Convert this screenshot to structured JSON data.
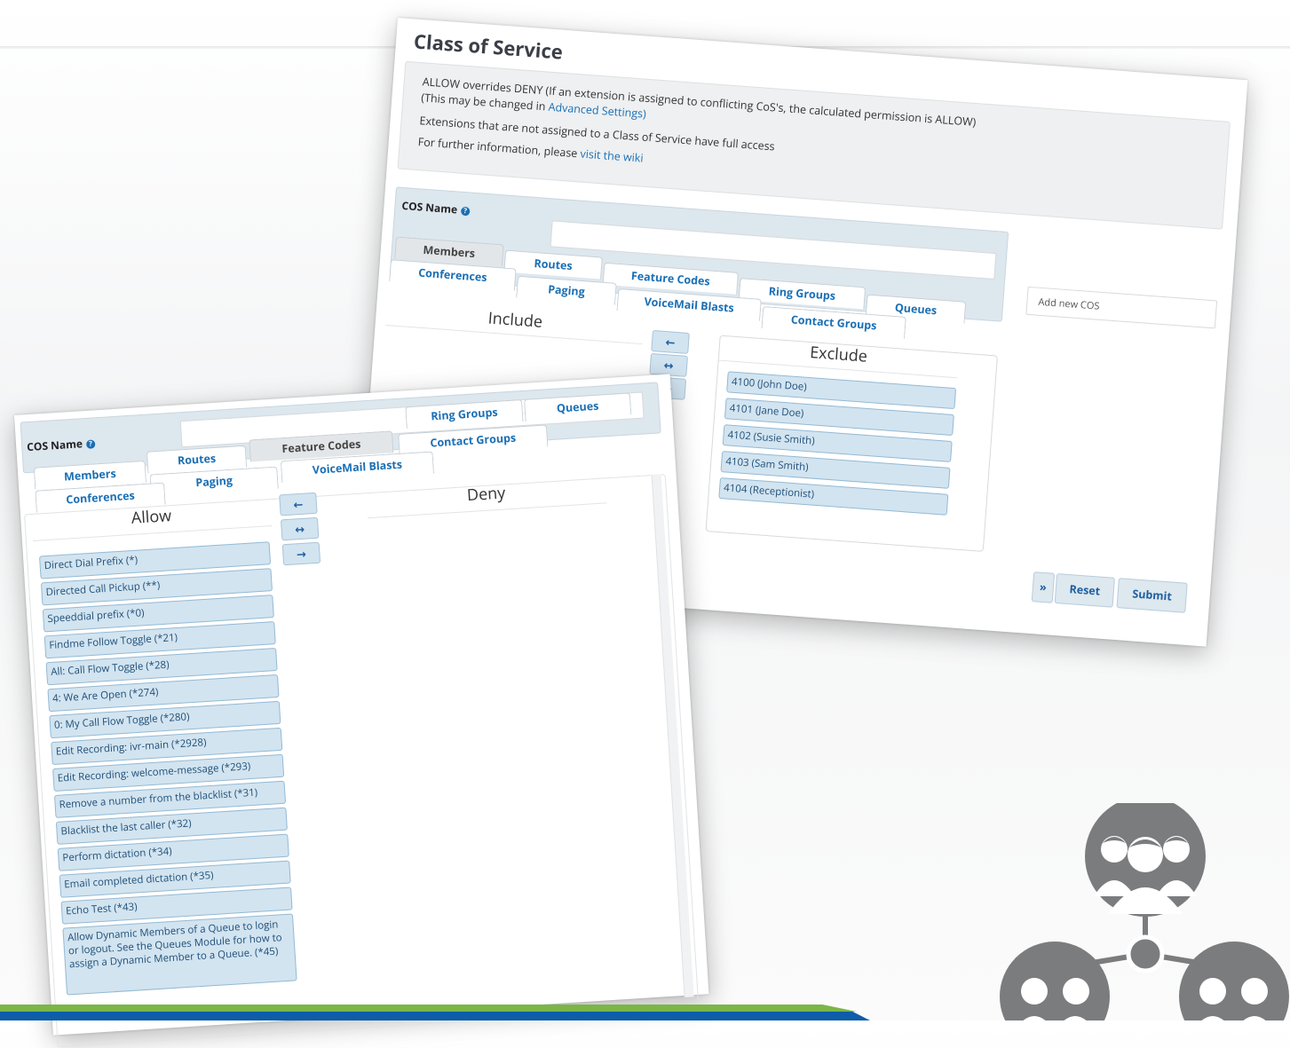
{
  "back": {
    "title": "Class of Service",
    "info": {
      "line1": "ALLOW overrides DENY (If an extension is assigned to conflicting CoS's, the calculated permission is ALLOW)",
      "line2_prefix": "(This may be changed in ",
      "line2_link": "Advanced Settings",
      "line2_suffix": ")",
      "line3": "Extensions that are not assigned to a Class of Service have full access",
      "line4_prefix": "For further information, please ",
      "line4_link": "visit the wiki"
    },
    "cos_name_label": "COS Name",
    "tabs": [
      "Members",
      "Routes",
      "Feature Codes",
      "Ring Groups",
      "Queues",
      "Conferences",
      "Paging",
      "VoiceMail Blasts",
      "Contact Groups"
    ],
    "include_label": "Include",
    "exclude_label": "Exclude",
    "exclude_items": [
      "4100 (John Doe)",
      "4101 (Jane Doe)",
      "4102 (Susie Smith)",
      "4103 (Sam Smith)",
      "4104 (Receptionist)"
    ],
    "add_new_cos_placeholder": "Add new COS",
    "reset_label": "Reset",
    "submit_label": "Submit",
    "collapse_label": "»"
  },
  "front": {
    "cos_name_label": "COS Name",
    "tabs": [
      "Members",
      "Routes",
      "Feature Codes",
      "Ring Groups",
      "Queues",
      "Conferences",
      "Paging",
      "VoiceMail Blasts",
      "Contact Groups"
    ],
    "allow_label": "Allow",
    "deny_label": "Deny",
    "allow_items": [
      "Direct Dial Prefix (*)",
      "Directed Call Pickup (**)",
      "Speeddial prefix (*0)",
      "Findme Follow Toggle (*21)",
      "All: Call Flow Toggle (*28)",
      "4: We Are Open (*274)",
      "0: My Call Flow Toggle (*280)",
      "Edit Recording: ivr-main (*2928)",
      "Edit Recording: welcome-message (*293)",
      "Remove a number from the blacklist (*31)",
      "Blacklist the last caller (*32)",
      "Perform dictation (*34)",
      "Email completed dictation (*35)",
      "Echo Test (*43)",
      "Allow Dynamic Members of a Queue to login or logout. See the Queues Module for how to assign a Dynamic Member to a Queue. (*45)"
    ]
  },
  "arrows": {
    "left": "←",
    "both": "↔",
    "right": "→"
  },
  "colors": {
    "link": "#1a6fb5",
    "item_bg": "#d2e4f0",
    "icon_gray": "#7b7c7e",
    "green": "#7ab648",
    "blue": "#0e5da8"
  }
}
